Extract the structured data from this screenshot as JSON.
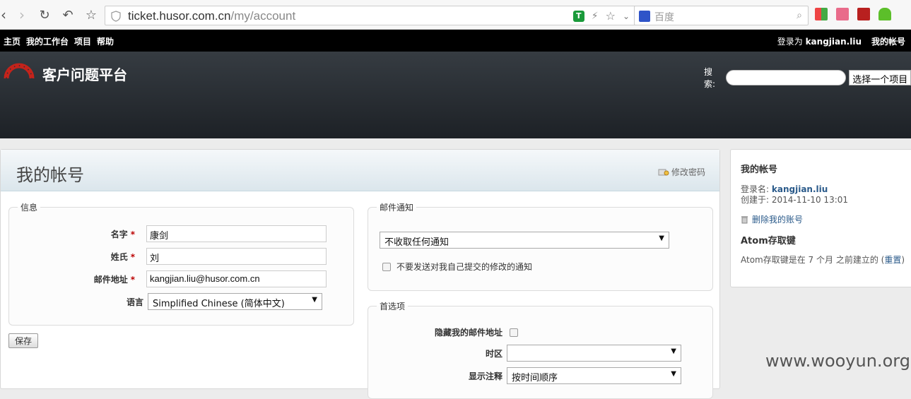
{
  "browser": {
    "url_host": "ticket.husor.com.cn",
    "url_path": "/my/account",
    "search_placeholder": "百度"
  },
  "top_menu": {
    "items": [
      "主页",
      "我的工作台",
      "项目",
      "帮助"
    ],
    "logged_in_prefix": "登录为",
    "username": "kangjian.liu",
    "my_account": "我的帐号"
  },
  "header": {
    "site_title": "客户问题平台",
    "search_label": "搜索:",
    "project_jump": "选择一个项目"
  },
  "page": {
    "title": "我的帐号",
    "change_password": "修改密码"
  },
  "info": {
    "legend": "信息",
    "firstname_label": "名字",
    "firstname_value": "康剑",
    "lastname_label": "姓氏",
    "lastname_value": "刘",
    "email_label": "邮件地址",
    "email_value": "kangjian.liu@husor.com.cn",
    "language_label": "语言",
    "language_value": "Simplified Chinese (简体中文)",
    "required_mark": "*"
  },
  "save_label": "保存",
  "mail_notification": {
    "legend": "邮件通知",
    "option": "不收取任何通知",
    "no_self_notified": "不要发送对我自己提交的修改的通知"
  },
  "preferences": {
    "legend": "首选项",
    "hide_mail_label": "隐藏我的邮件地址",
    "timezone_label": "时区",
    "timezone_value": "",
    "comments_sorting_label": "显示注释",
    "comments_sorting_value": "按时间顺序"
  },
  "sidebar": {
    "title": "我的帐号",
    "login_label": "登录名:",
    "login_value": "kangjian.liu",
    "created_label": "创建于:",
    "created_value": "2014-11-10 13:01",
    "delete_account": "删除我的账号",
    "atom_title": "Atom存取键",
    "atom_text": "Atom存取键是在 7 个月 之前建立的 (",
    "atom_reset": "重置",
    "atom_close": ")"
  },
  "watermark": "www.wooyun.org",
  "colors": {
    "top_menu_bg": "#000000",
    "header_bg": "#2b3036",
    "link": "#2a5a8a",
    "required": "#bb0000"
  }
}
